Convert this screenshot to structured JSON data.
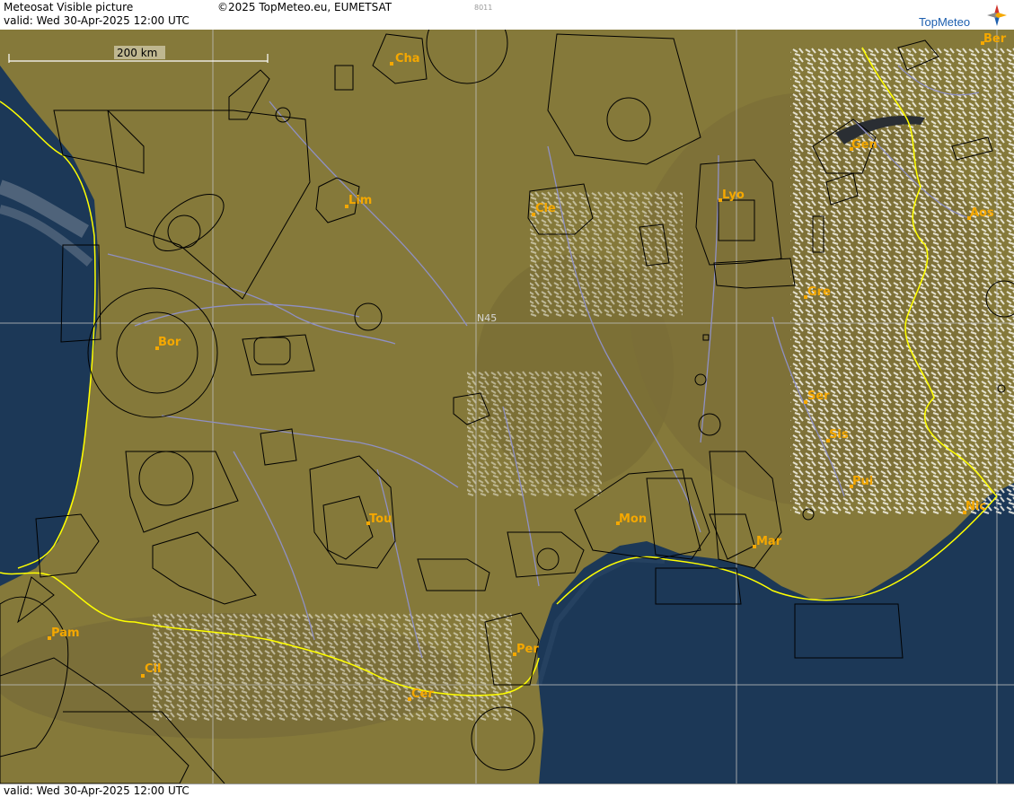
{
  "header": {
    "product": "Meteosat Visible picture",
    "copyright": "©2025 TopMeteo.eu, EUMETSAT",
    "code": "8011",
    "valid": "valid:  Wed  30-Apr-2025  12:00 UTC",
    "logo_text": "TopMeteo"
  },
  "footer": {
    "valid": "valid:  Wed  30-Apr-2025  12:00 UTC"
  },
  "map": {
    "scale_label": "200 km",
    "grid_label": "N45",
    "colors": {
      "land": "#85793a",
      "sea": "#1c3857",
      "snow": "#f4f1e6",
      "border": "#ffff00",
      "river": "#8f90c4",
      "airspace": "#000000",
      "city": "#f5a800",
      "grid": "#bfbfbf"
    },
    "cities": [
      "Cha",
      "Ber",
      "Gen",
      "Lim",
      "Cle",
      "Lyo",
      "Aos",
      "Gre",
      "Bor",
      "Ser",
      "Sis",
      "Pui",
      "Tou",
      "Mon",
      "Mar",
      "Nic",
      "Pam",
      "Cil",
      "Per",
      "Cer"
    ]
  }
}
